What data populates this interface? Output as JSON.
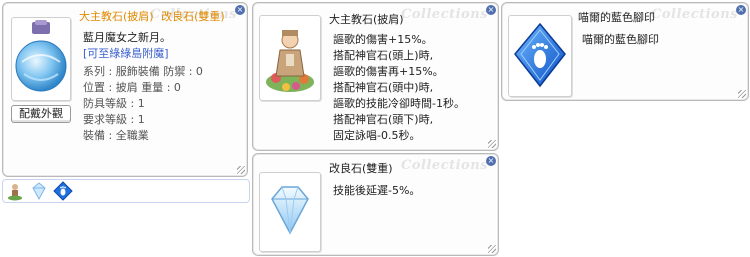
{
  "watermark": "Collections",
  "window1": {
    "title_left": "大主教石(披肩)",
    "title_right": "改良石(雙重)",
    "lines": [
      {
        "text": "藍月魔女之新月。",
        "kind": "normal"
      },
      {
        "text": "[可至綠綠島附魔]",
        "kind": "link"
      },
      {
        "text": "系列 : 服飾裝備  防禦 : 0",
        "kind": "normal"
      },
      {
        "text": "位置 : 披肩  重量 : 0",
        "kind": "normal"
      },
      {
        "text": "防具等級 : 1",
        "kind": "normal"
      },
      {
        "text": "要求等級 : 1",
        "kind": "normal"
      },
      {
        "text": "裝備 : 全職業",
        "kind": "normal"
      }
    ],
    "button_label": "配戴外觀"
  },
  "window2": {
    "title": "大主教石(披肩)",
    "lines": [
      "謳歌的傷害+15%。",
      "搭配神官石(頭上)時,",
      "謳歌的傷害再+15%。",
      "搭配神官石(頭中)時,",
      "謳歌的技能冷卻時間-1秒。",
      "搭配神官石(頭下)時,",
      "固定詠唱-0.5秒。"
    ]
  },
  "window3": {
    "title": "改良石(雙重)",
    "lines": [
      "技能後延遲-5%。"
    ]
  },
  "window4": {
    "title": "喵爾的藍色腳印",
    "lines": [
      "喵爾的藍色腳印"
    ]
  },
  "item_bar": {
    "slots": [
      "figure-icon",
      "diamond-icon",
      "blue-footprint-icon"
    ]
  },
  "colors": {
    "title_orange": "#e08a00",
    "link_blue": "#3a5fcd",
    "gem_blue": "#1e6fe0"
  }
}
